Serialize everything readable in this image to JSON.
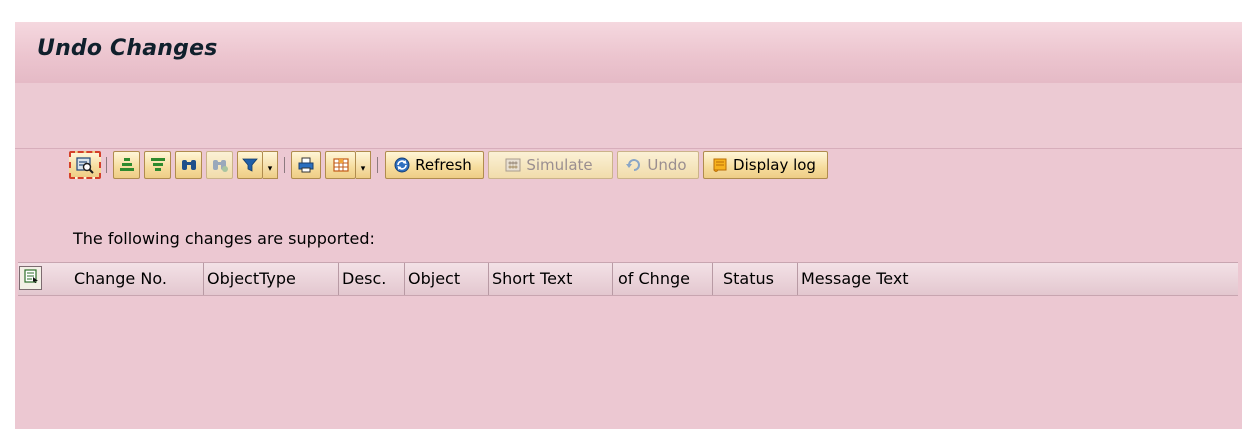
{
  "window": {
    "title": "Undo Changes"
  },
  "toolbar": {
    "details_icon": "magnifier-details-icon",
    "sort_ascending_icon": "sort-ascending-icon",
    "sort_descending_icon": "sort-descending-icon",
    "find_icon": "binoculars-icon",
    "find_next_icon": "binoculars-plus-icon",
    "filter_icon": "filter-icon",
    "print_icon": "printer-icon",
    "layout_icon": "grid-layout-icon",
    "refresh_label": "Refresh",
    "simulate_label": "Simulate",
    "undo_label": "Undo",
    "display_log_label": "Display log"
  },
  "notice": {
    "text": "The following changes are supported:"
  },
  "table": {
    "columns": [
      "Change No.",
      "ObjectType",
      "Desc.",
      "Object",
      "Short Text",
      "of Chnge",
      "Status",
      "Message Text"
    ]
  },
  "colors": {
    "background": "#ecc8d2",
    "button": "#f6dc9c",
    "focus_border": "#d4402a"
  }
}
